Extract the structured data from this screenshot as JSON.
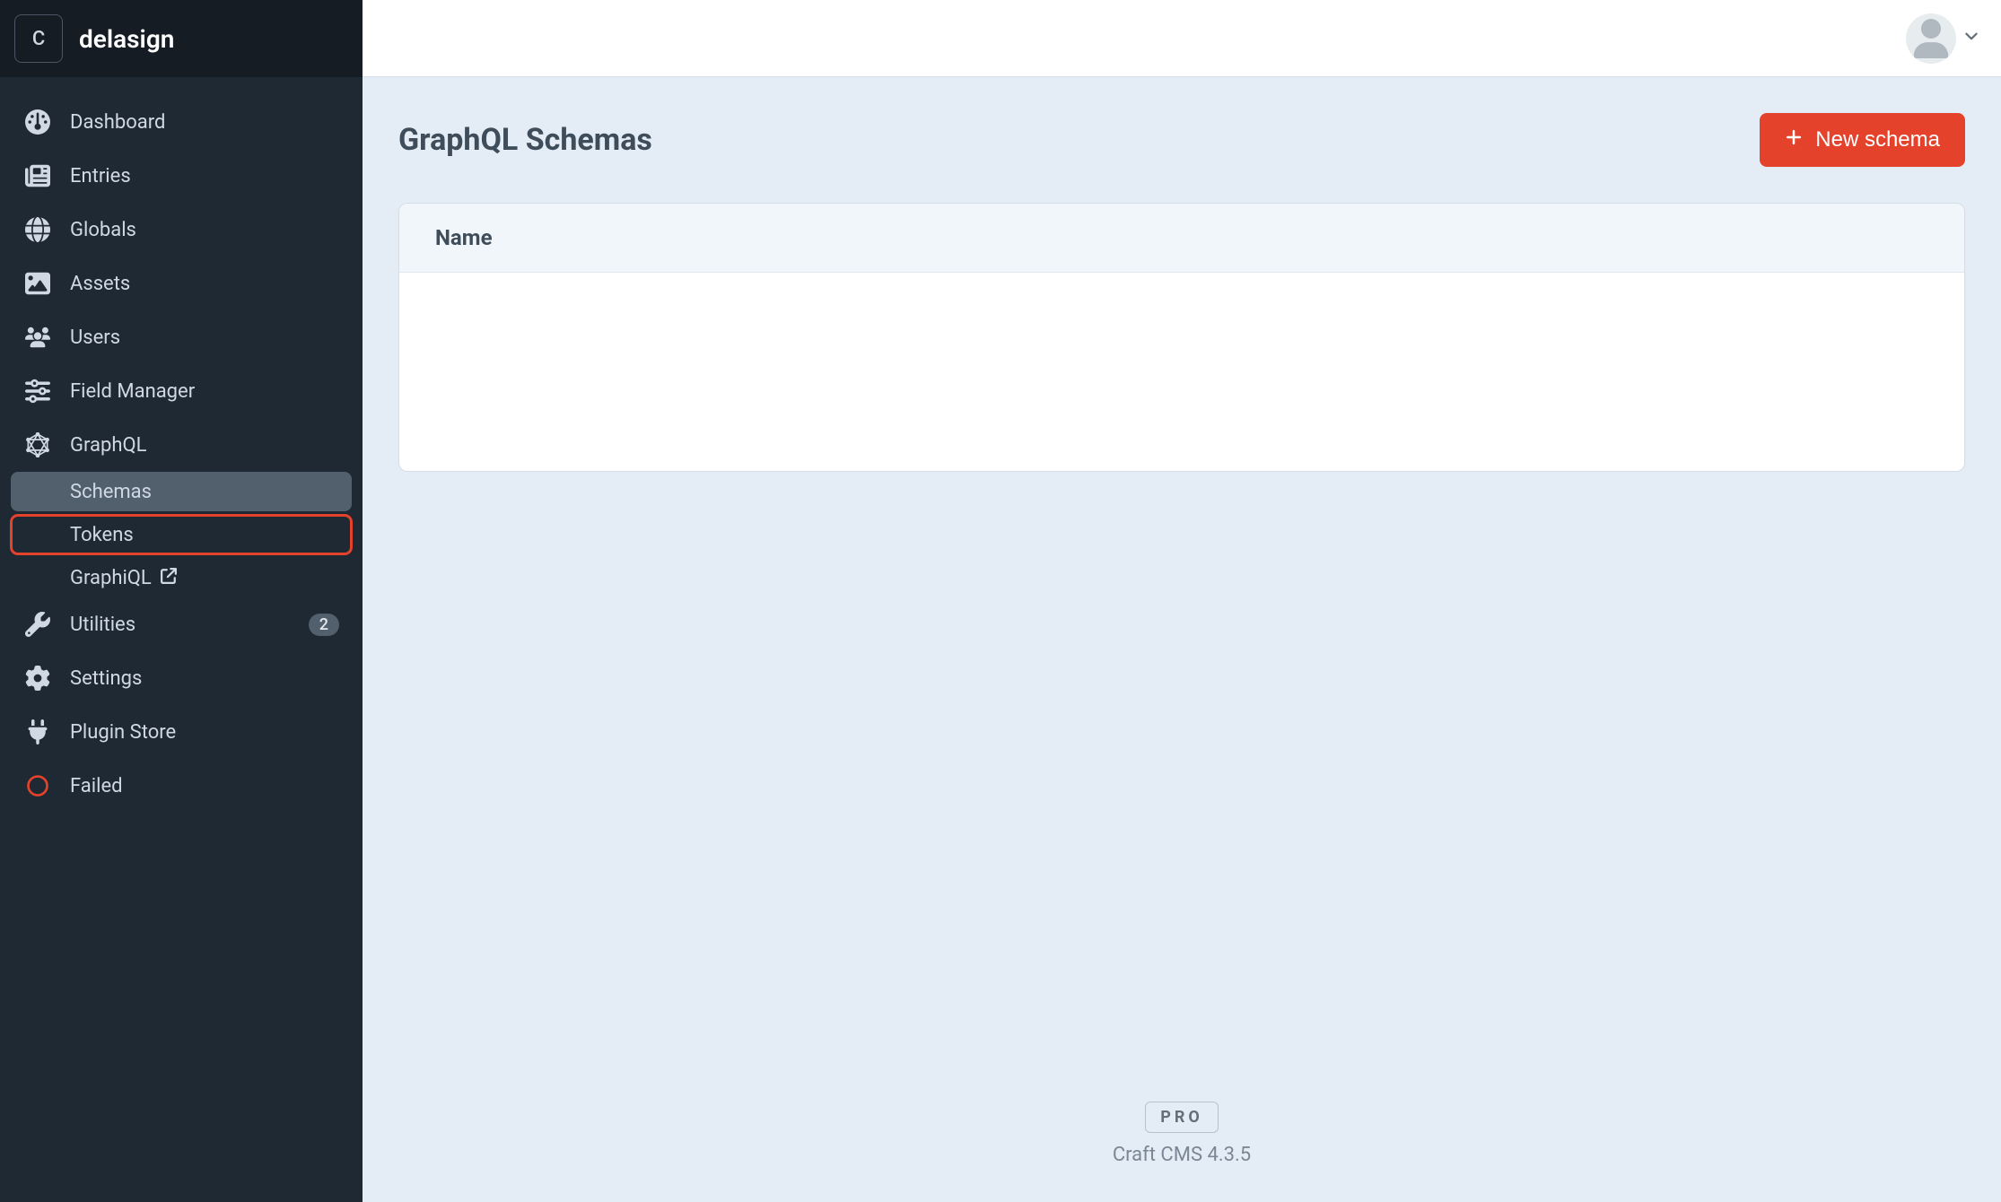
{
  "app": {
    "logo_letter": "C",
    "site_name": "delasign"
  },
  "sidebar": {
    "items": [
      {
        "label": "Dashboard"
      },
      {
        "label": "Entries"
      },
      {
        "label": "Globals"
      },
      {
        "label": "Assets"
      },
      {
        "label": "Users"
      },
      {
        "label": "Field Manager"
      },
      {
        "label": "GraphQL"
      }
    ],
    "graphql_subnav": [
      {
        "label": "Schemas"
      },
      {
        "label": "Tokens"
      },
      {
        "label": "GraphiQL"
      }
    ],
    "utilities": {
      "label": "Utilities",
      "badge": "2"
    },
    "settings": {
      "label": "Settings"
    },
    "plugin_store": {
      "label": "Plugin Store"
    },
    "failed": {
      "label": "Failed"
    }
  },
  "page": {
    "title": "GraphQL Schemas",
    "new_button_label": "New schema",
    "table": {
      "columns": [
        "Name"
      ],
      "rows": []
    }
  },
  "footer": {
    "edition_badge": "PRO",
    "product": "Craft CMS 4.3.5"
  }
}
